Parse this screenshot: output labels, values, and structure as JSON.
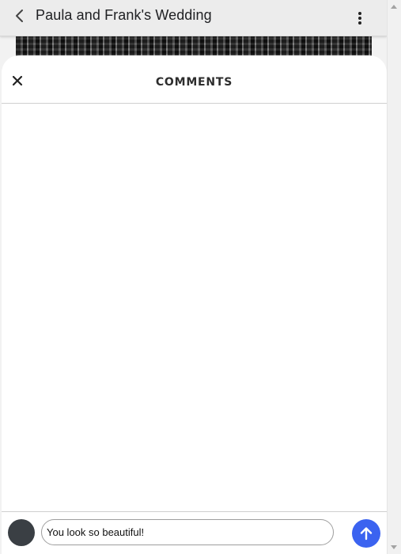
{
  "header": {
    "title": "Paula and Frank's Wedding",
    "back_icon": "chevron-left-icon",
    "more_icon": "more-vertical-icon"
  },
  "sheet": {
    "title": "COMMENTS",
    "close_icon": "close-icon"
  },
  "composer": {
    "input_value": "You look so beautiful!",
    "send_icon": "arrow-up-icon"
  },
  "colors": {
    "accent": "#3b63f0",
    "avatar": "#3a3f44"
  }
}
